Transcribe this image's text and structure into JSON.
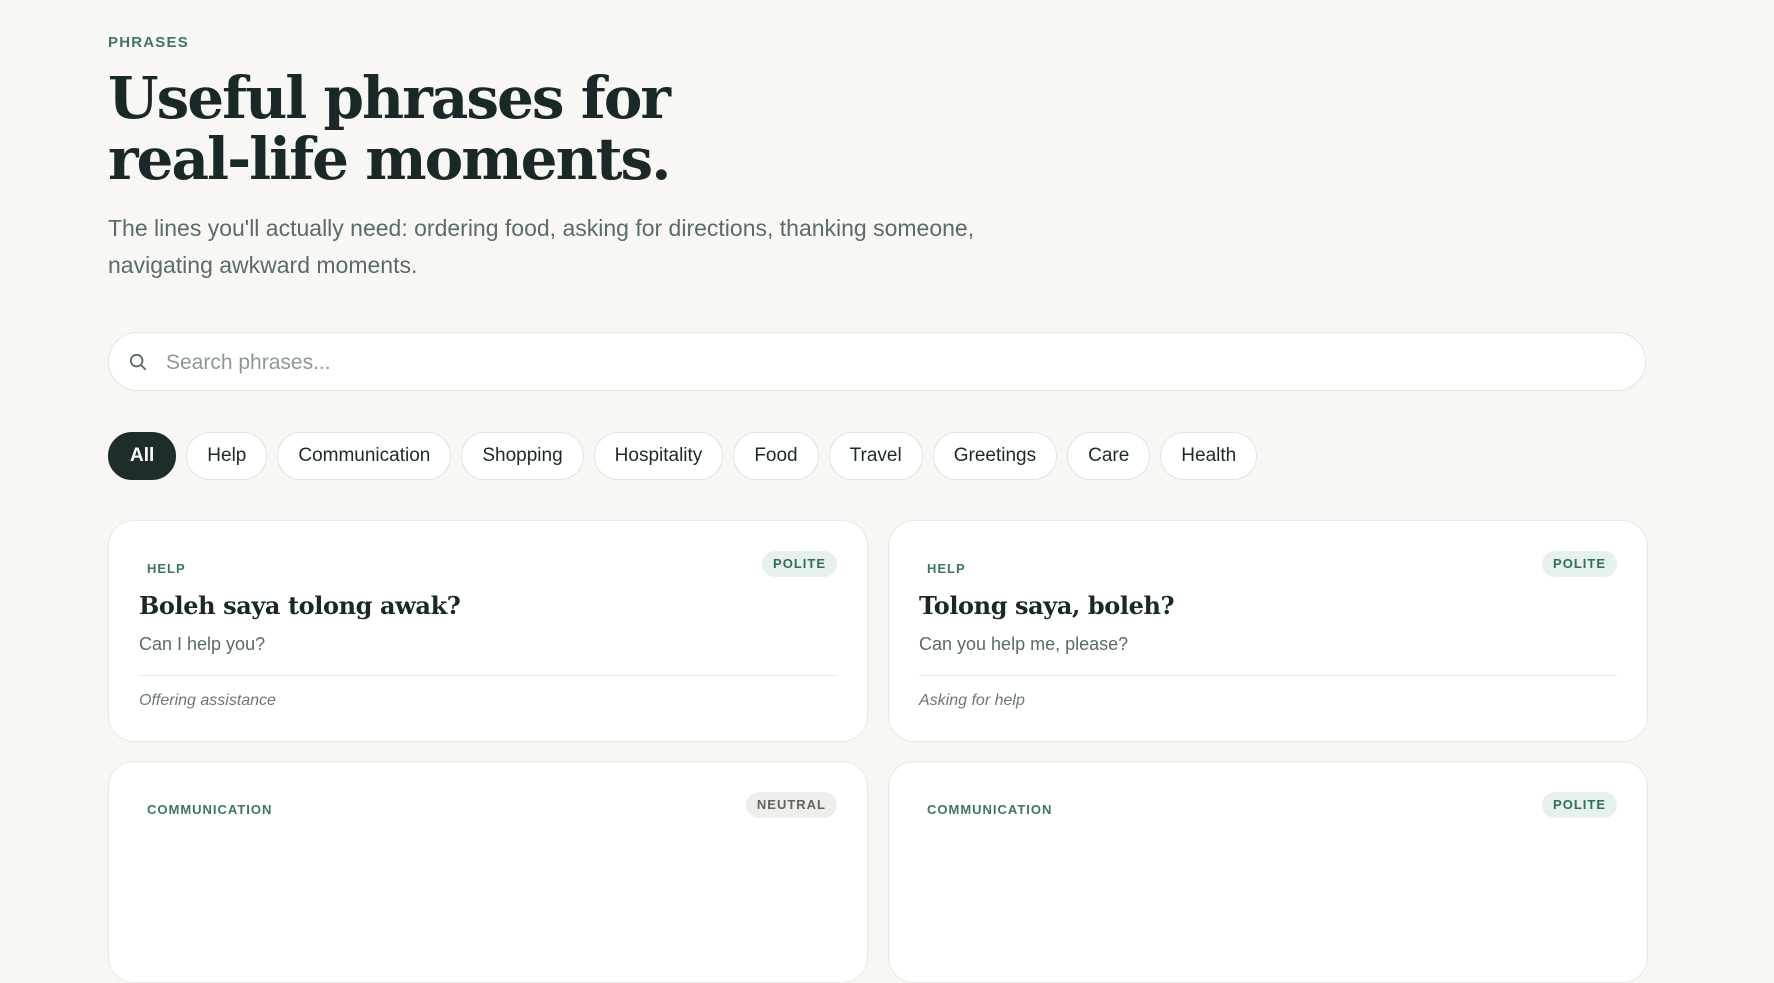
{
  "header": {
    "eyebrow": "PHRASES",
    "title_line1": "Useful phrases for",
    "title_line2": "real-life moments.",
    "subtitle": "The lines you'll actually need: ordering food, asking for directions, thanking someone, navigating awkward moments."
  },
  "search": {
    "placeholder": "Search phrases...",
    "value": ""
  },
  "filters": {
    "items": [
      {
        "label": "All",
        "active": true
      },
      {
        "label": "Help"
      },
      {
        "label": "Communication"
      },
      {
        "label": "Shopping"
      },
      {
        "label": "Hospitality"
      },
      {
        "label": "Food"
      },
      {
        "label": "Travel"
      },
      {
        "label": "Greetings"
      },
      {
        "label": "Care"
      },
      {
        "label": "Health"
      }
    ]
  },
  "cards": [
    {
      "category": "HELP",
      "tone": "POLITE",
      "phrase": "Boleh saya tolong awak?",
      "meaning": "Can I help you?",
      "context": "Offering assistance"
    },
    {
      "category": "HELP",
      "tone": "POLITE",
      "phrase": "Tolong saya, boleh?",
      "meaning": "Can you help me, please?",
      "context": "Asking for help"
    },
    {
      "category": "COMMUNICATION",
      "tone": "NEUTRAL"
    },
    {
      "category": "COMMUNICATION",
      "tone": "POLITE"
    }
  ],
  "colors": {
    "background": "#f8f7f4",
    "accent": "#3f7468",
    "active_chip": "#1d2d2b",
    "polite_badge_bg": "#e6f1ec",
    "neutral_badge_bg": "#eeeeea"
  }
}
